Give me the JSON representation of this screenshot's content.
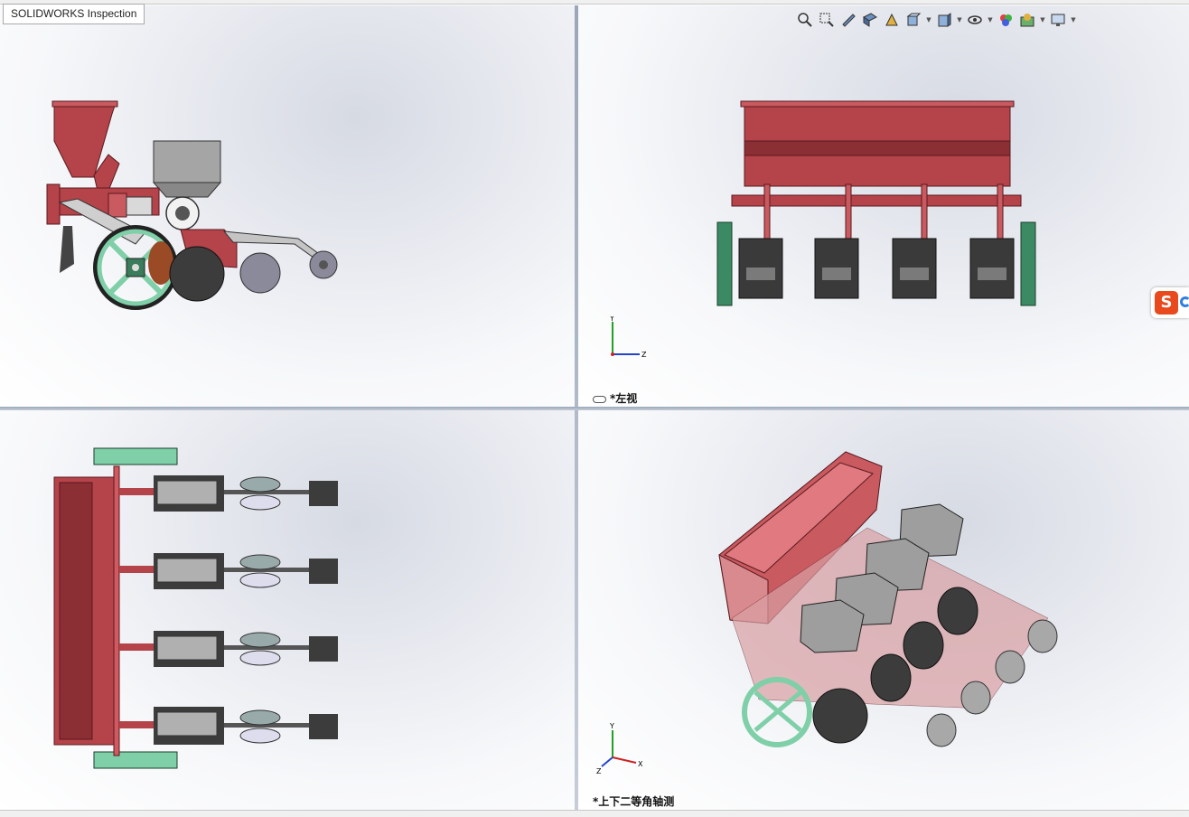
{
  "app": {
    "tab_title": "SOLIDWORKS Inspection"
  },
  "viewports": {
    "top_left": {
      "label": ""
    },
    "top_right": {
      "label": "*左视"
    },
    "bottom_left": {
      "label": ""
    },
    "bottom_right": {
      "label": "*上下二等角轴测"
    }
  },
  "triad": {
    "x": "X",
    "y": "Y",
    "z": "Z"
  },
  "toolbar": [
    {
      "icon": "zoom-to-fit-icon"
    },
    {
      "icon": "zoom-to-area-icon"
    },
    {
      "icon": "previous-view-icon"
    },
    {
      "icon": "section-view-icon"
    },
    {
      "icon": "dynamic-annotation-icon"
    },
    {
      "icon": "view-orientation-icon"
    },
    {
      "icon": "display-style-icon"
    },
    {
      "icon": "hide-show-items-icon"
    },
    {
      "icon": "edit-appearance-icon"
    },
    {
      "icon": "apply-scene-icon"
    },
    {
      "icon": "view-settings-icon"
    }
  ],
  "ime": {
    "icon": "sogou-ime-icon",
    "letter": "S"
  },
  "colors": {
    "frame_red": "#b5434a",
    "hopper_gray": "#9e9e9e",
    "wheel_green": "#7fcfa8",
    "tire_dark": "#3c3c3c",
    "viewport_border": "#9aa7b8"
  }
}
